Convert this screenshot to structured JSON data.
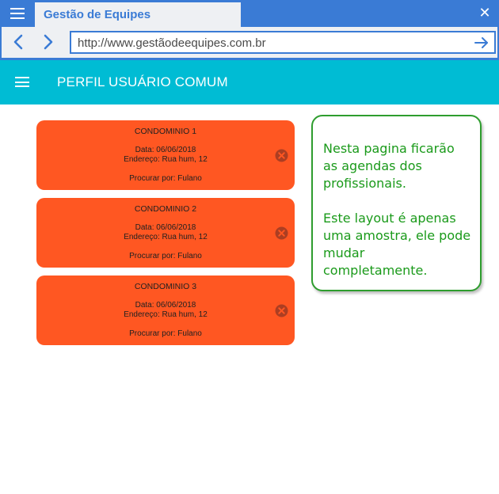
{
  "browser": {
    "tab_title": "Gestão de Equipes",
    "url": "http://www.gestãodeequipes.com.br",
    "close_symbol": "✕"
  },
  "appbar": {
    "title": "PERFIL USUÁRIO COMUM"
  },
  "cards": [
    {
      "title": "CONDOMINIO 1",
      "date": "Data: 06/06/2018",
      "address": "Endereço: Rua hum, 12",
      "requested_by": "Procurar por: Fulano"
    },
    {
      "title": "CONDOMINIO 2",
      "date": "Data: 06/06/2018",
      "address": "Endereço: Rua hum, 12",
      "requested_by": "Procurar por: Fulano"
    },
    {
      "title": "CONDOMINIO 3",
      "date": "Data: 06/06/2018",
      "address": "Endereço: Rua hum, 12",
      "requested_by": "Procurar por: Fulano"
    }
  ],
  "note": {
    "paragraph1": "Nesta pagina ficarão as agendas dos profissionais.",
    "paragraph2": "Este layout é apenas uma amostra, ele pode mudar completamente."
  },
  "icons": {
    "browser_menu": "hamburger-icon",
    "close": "close-icon",
    "back": "chevron-left-icon",
    "forward": "chevron-right-icon",
    "go": "arrow-right-icon",
    "app_menu": "hamburger-icon",
    "card_remove": "remove-circle-icon"
  },
  "colors": {
    "browser_chrome": "#3a7bd5",
    "app_bar": "#00bcd4",
    "card": "#ff5722",
    "note_text": "#1a9a1a"
  }
}
